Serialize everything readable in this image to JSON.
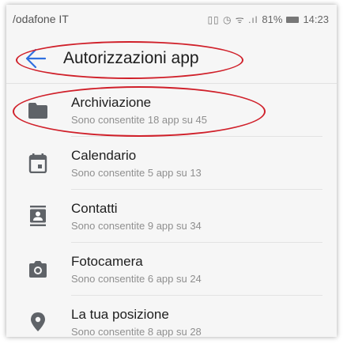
{
  "status_bar": {
    "carrier": "/odafone IT",
    "icons": "▯▯ ◷ ᯤ .ıl",
    "battery_percent": "81%",
    "time": "14:23"
  },
  "app_bar": {
    "back_icon": "arrow-left-icon",
    "title": "Autorizzazioni app"
  },
  "permissions": [
    {
      "icon": "folder-icon",
      "label": "Archiviazione",
      "subtitle": "Sono consentite 18 app su 45"
    },
    {
      "icon": "calendar-icon",
      "label": "Calendario",
      "subtitle": "Sono consentite 5 app su 13"
    },
    {
      "icon": "contacts-icon",
      "label": "Contatti",
      "subtitle": "Sono consentite 9 app su 34"
    },
    {
      "icon": "camera-icon",
      "label": "Fotocamera",
      "subtitle": "Sono consentite 6 app su 24"
    },
    {
      "icon": "location-pin-icon",
      "label": "La tua posizione",
      "subtitle": "Sono consentite 8 app su 28"
    }
  ],
  "colors": {
    "accent": "#2f6fe0",
    "annotation": "#d0202a",
    "icon": "#5f6368"
  }
}
